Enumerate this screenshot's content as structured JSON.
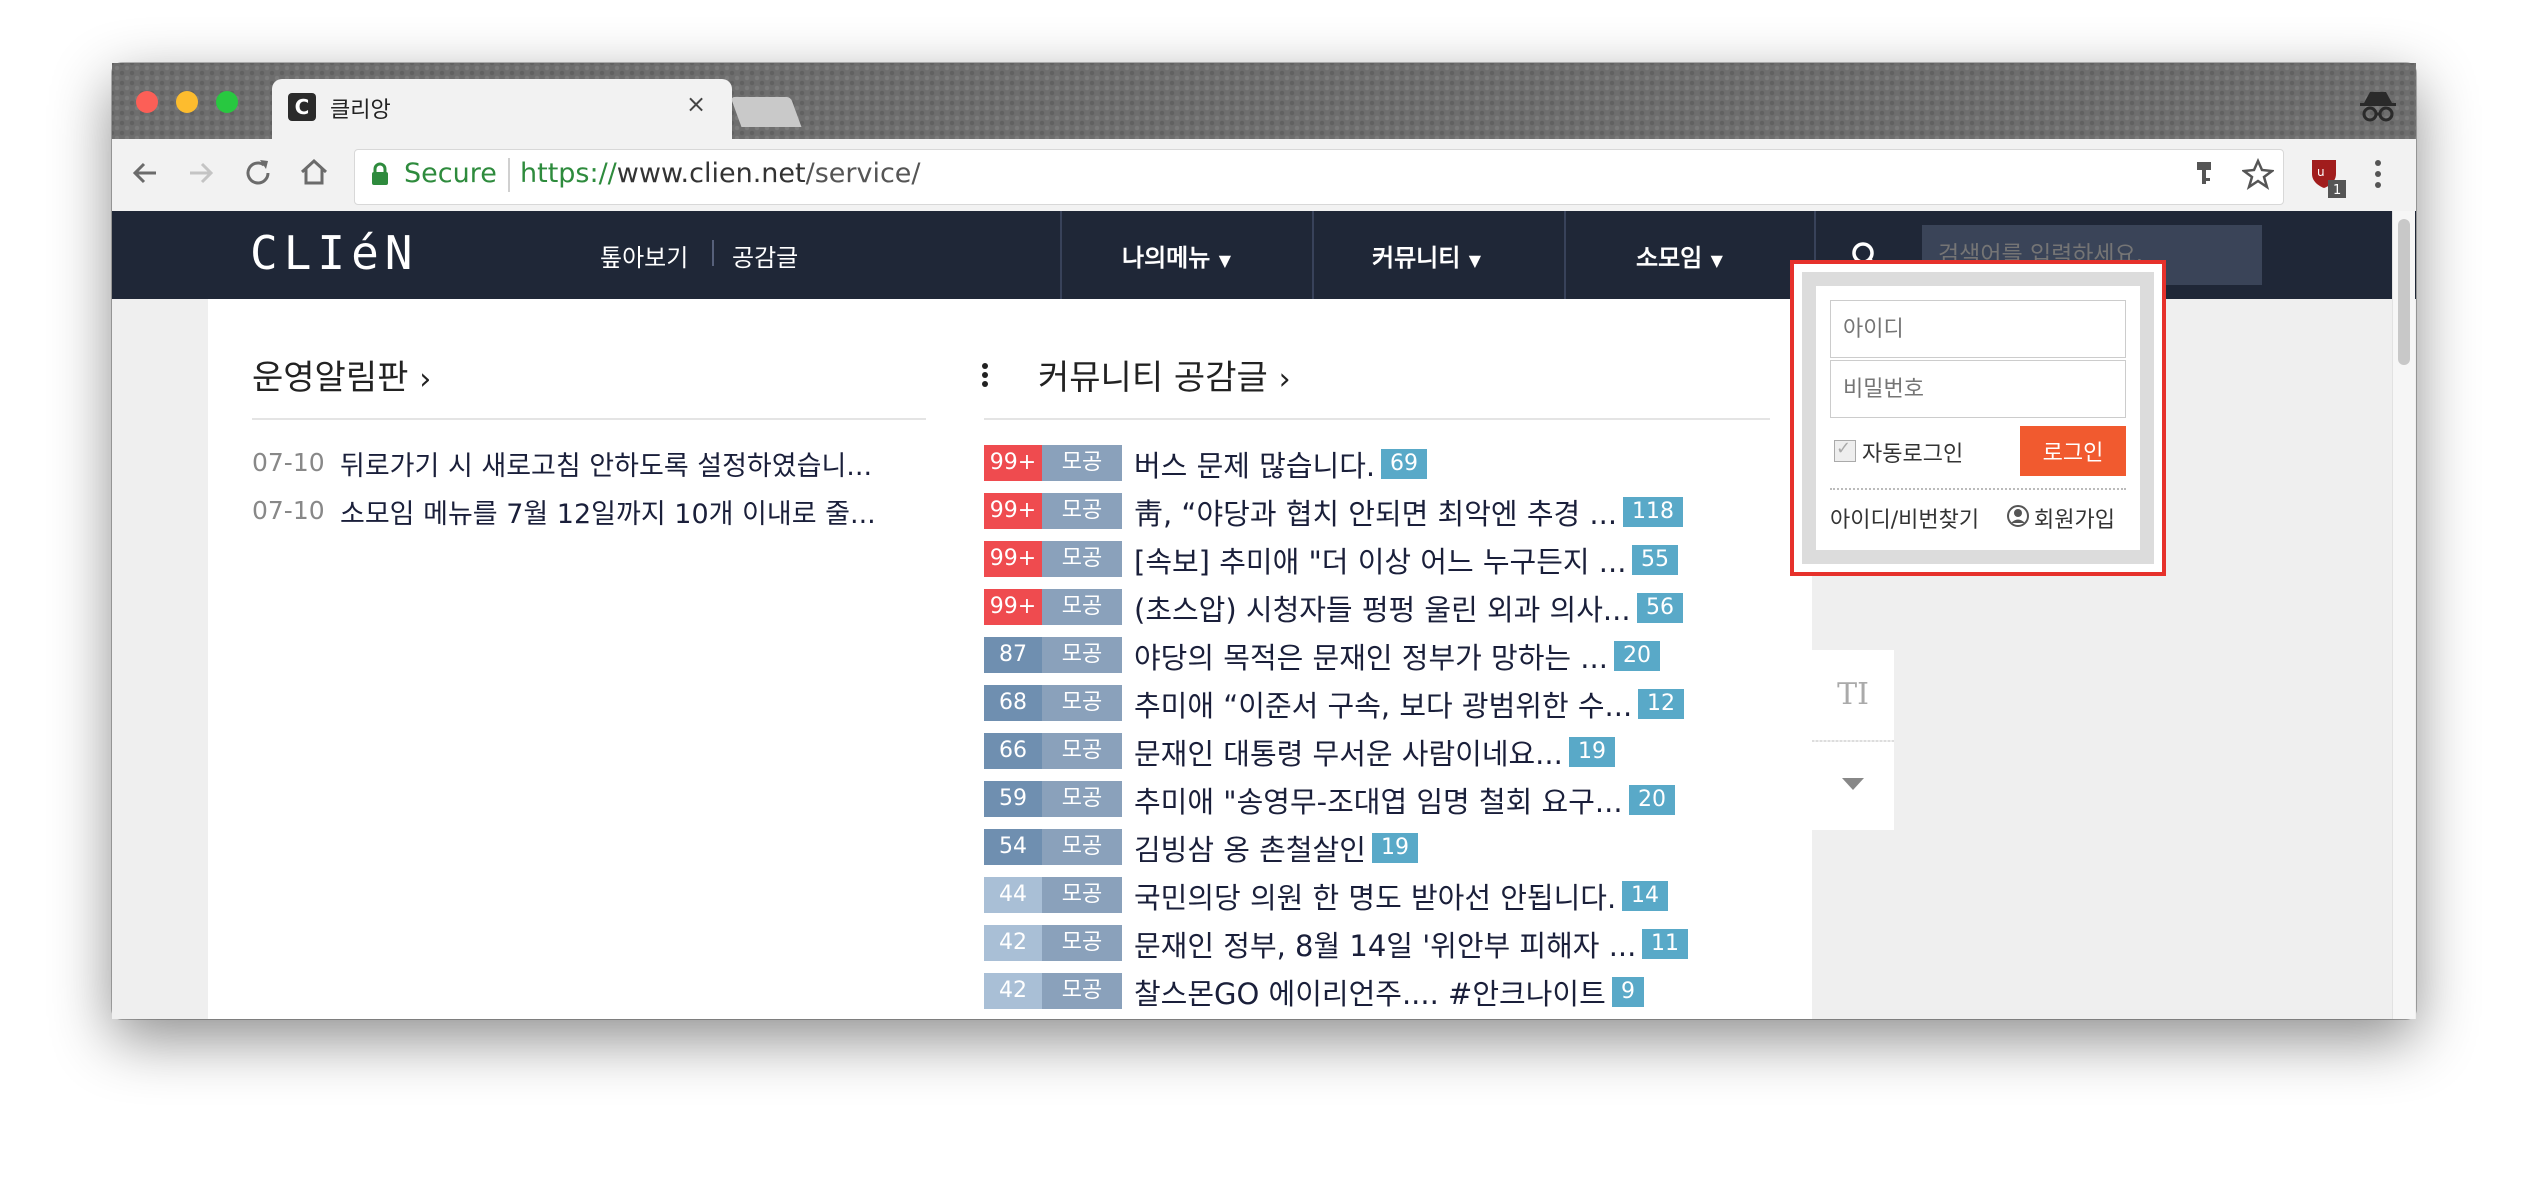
{
  "browser": {
    "tab_title": "클리앙",
    "tab_favicon": "C",
    "tab_close": "×",
    "secure_label": "Secure",
    "url_scheme": "https://",
    "url_host": "www.clien.net",
    "url_path": "/service/",
    "extension_badge": "1"
  },
  "header": {
    "logo": "CLIéN",
    "nav_links": [
      "톺아보기",
      "공감글"
    ],
    "menus": [
      "나의메뉴",
      "커뮤니티",
      "소모임"
    ],
    "search_placeholder": "검색어를 입력하세요."
  },
  "notice": {
    "title": "운영알림판",
    "items": [
      {
        "date": "07-10",
        "text": "뒤로가기 시 새로고침 안하도록 설정하였습니..."
      },
      {
        "date": "07-10",
        "text": "소모임 메뉴를 7월 12일까지 10개 이내로 줄..."
      }
    ]
  },
  "community": {
    "title": "커뮤니티 공감글",
    "tag_label": "모공",
    "posts": [
      {
        "count": "99+",
        "title": "버스 문제 많습니다.",
        "comments": "69"
      },
      {
        "count": "99+",
        "title": "靑, “야당과 협치 안되면 최악엔 추경 ...",
        "comments": "118"
      },
      {
        "count": "99+",
        "title": "[속보] 추미애 \"더 이상 어느 누구든지 ...",
        "comments": "55"
      },
      {
        "count": "99+",
        "title": "(초스압) 시청자들 펑펑 울린 외과 의사...",
        "comments": "56"
      },
      {
        "count": "87",
        "title": "야당의 목적은 문재인 정부가 망하는 ...",
        "comments": "20"
      },
      {
        "count": "68",
        "title": "추미애 “이준서 구속, 보다 광범위한 수...",
        "comments": "12"
      },
      {
        "count": "66",
        "title": "문재인 대통령 무서운 사람이네요...",
        "comments": "19"
      },
      {
        "count": "59",
        "title": "추미애 \"송영무-조대엽 임명 철회 요구...",
        "comments": "20"
      },
      {
        "count": "54",
        "title": "김빙삼 옹 촌철살인",
        "comments": "19"
      },
      {
        "count": "44",
        "title": "국민의당 의원 한 명도 받아선 안됩니다.",
        "comments": "14"
      },
      {
        "count": "42",
        "title": "문재인 정부, 8월 14일 '위안부 피해자 ...",
        "comments": "11"
      },
      {
        "count": "42",
        "title": "찰스몬GO 에이리언주.... #안크나이트",
        "comments": "9"
      }
    ]
  },
  "login": {
    "id_placeholder": "아이디",
    "pw_placeholder": "비밀번호",
    "auto_login_label": "자동로그인",
    "login_button": "로그인",
    "find_link": "아이디/비번찾기",
    "signup_link": "회원가입"
  },
  "side_tools": {
    "font_size_label": "TI"
  },
  "colors": {
    "header_bg": "#1f2737",
    "hot_red": "#ef4b4f",
    "count_blue": "#6f8fb0",
    "count_light": "#a9bfd6",
    "comment_badge": "#59a9c8",
    "login_button": "#f15a2f",
    "highlight_border": "#e6312b"
  }
}
